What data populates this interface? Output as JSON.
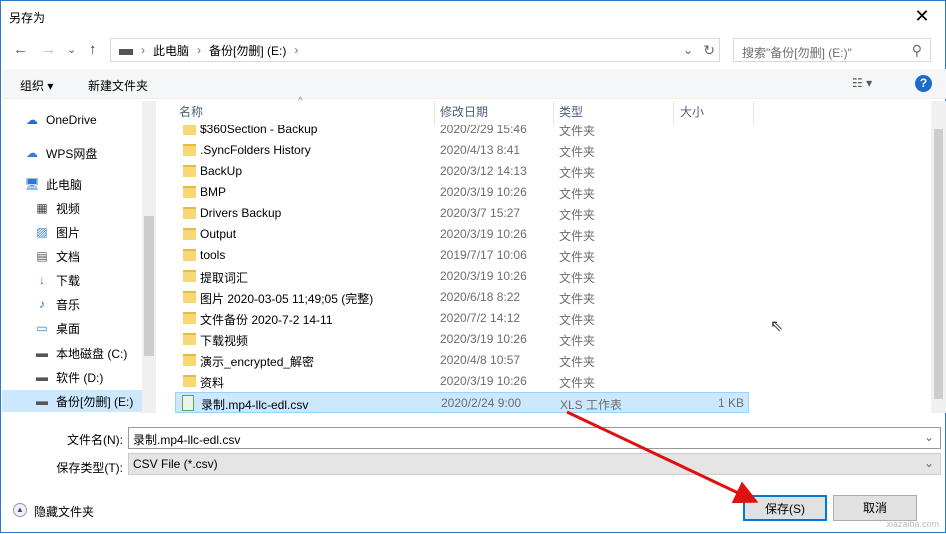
{
  "window": {
    "title": "另存为",
    "close": "✕"
  },
  "nav": {
    "back": "←",
    "forward": "→",
    "recent": "⌄",
    "up": "↑"
  },
  "address": {
    "crumbs": [
      "此电脑",
      "备份[勿删] (E:)"
    ],
    "sep": "›",
    "dropdown": "⌄",
    "refresh": "↻"
  },
  "search": {
    "placeholder": "搜索\"备份[勿删] (E:)\"",
    "icon": "⚲"
  },
  "toolbar": {
    "organize": "组织 ▾",
    "new_folder": "新建文件夹",
    "view": "☷ ▾",
    "help": "?"
  },
  "sidebar": {
    "items": [
      {
        "label": "OneDrive",
        "icon": "☁",
        "color": "#1e6fd9"
      },
      {
        "label": "WPS网盘",
        "icon": "☁",
        "color": "#3a7bd5"
      },
      {
        "label": "此电脑",
        "icon": "🖥",
        "color": "#2a7ad2"
      },
      {
        "label": "视频",
        "icon": "▦",
        "color": "#444"
      },
      {
        "label": "图片",
        "icon": "▨",
        "color": "#3a7bd5"
      },
      {
        "label": "文档",
        "icon": "▤",
        "color": "#555"
      },
      {
        "label": "下载",
        "icon": "↓",
        "color": "#1e6fd9"
      },
      {
        "label": "音乐",
        "icon": "♪",
        "color": "#1e6fd9"
      },
      {
        "label": "桌面",
        "icon": "▭",
        "color": "#1e8ad9"
      },
      {
        "label": "本地磁盘 (C:)",
        "icon": "▬",
        "color": "#555"
      },
      {
        "label": "软件 (D:)",
        "icon": "▬",
        "color": "#555"
      },
      {
        "label": "备份[勿删] (E:)",
        "icon": "▬",
        "color": "#555"
      }
    ]
  },
  "columns": {
    "name": "名称",
    "date": "修改日期",
    "type": "类型",
    "size": "大小"
  },
  "files": [
    {
      "name": "$360Section - Backup",
      "date": "2020/2/29 15:46",
      "type": "文件夹",
      "size": ""
    },
    {
      "name": ".SyncFolders History",
      "date": "2020/4/13 8:41",
      "type": "文件夹",
      "size": ""
    },
    {
      "name": "BackUp",
      "date": "2020/3/12 14:13",
      "type": "文件夹",
      "size": ""
    },
    {
      "name": "BMP",
      "date": "2020/3/19 10:26",
      "type": "文件夹",
      "size": ""
    },
    {
      "name": "Drivers Backup",
      "date": "2020/3/7 15:27",
      "type": "文件夹",
      "size": ""
    },
    {
      "name": "Output",
      "date": "2020/3/19 10:26",
      "type": "文件夹",
      "size": ""
    },
    {
      "name": "tools",
      "date": "2019/7/17 10:06",
      "type": "文件夹",
      "size": ""
    },
    {
      "name": "提取词汇",
      "date": "2020/3/19 10:26",
      "type": "文件夹",
      "size": ""
    },
    {
      "name": "图片 2020-03-05 11;49;05 (完整)",
      "date": "2020/6/18 8:22",
      "type": "文件夹",
      "size": ""
    },
    {
      "name": "文件备份 2020-7-2 14-11",
      "date": "2020/7/2 14:12",
      "type": "文件夹",
      "size": ""
    },
    {
      "name": "下载视频",
      "date": "2020/3/19 10:26",
      "type": "文件夹",
      "size": ""
    },
    {
      "name": "演示_encrypted_解密",
      "date": "2020/4/8 10:57",
      "type": "文件夹",
      "size": ""
    },
    {
      "name": "资料",
      "date": "2020/3/19 10:26",
      "type": "文件夹",
      "size": ""
    },
    {
      "name": "录制.mp4-llc-edl.csv",
      "date": "2020/2/24 9:00",
      "type": "XLS 工作表",
      "size": "1 KB",
      "selected": true
    }
  ],
  "form": {
    "filename_label": "文件名(N):",
    "filename_value": "录制.mp4-llc-edl.csv",
    "type_label": "保存类型(T):",
    "type_value": "CSV File (*.csv)",
    "chevron": "⌄"
  },
  "footer": {
    "hide_folders": "隐藏文件夹",
    "save": "保存(S)",
    "cancel": "取消"
  },
  "watermark": "xiazaiba.com"
}
